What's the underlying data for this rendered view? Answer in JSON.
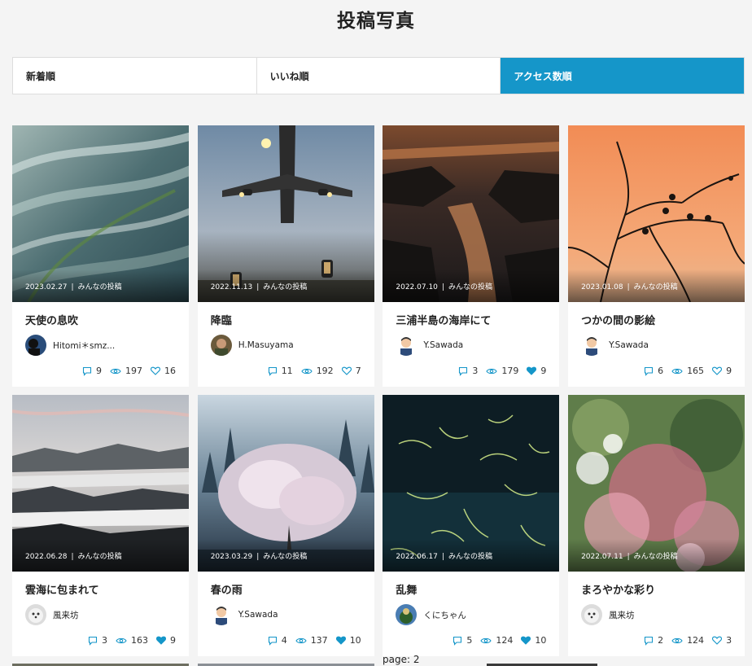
{
  "page": {
    "title": "投稿写真",
    "pager": "page: 2"
  },
  "sort_tabs": [
    {
      "label": "新着順",
      "active": false
    },
    {
      "label": "いいね順",
      "active": false
    },
    {
      "label": "アクセス数順",
      "active": true
    }
  ],
  "posts": [
    {
      "date": "2023.02.27",
      "category": "みんなの投稿",
      "title": "天使の息吹",
      "author": "Hitomi＊smz...",
      "comments": "9",
      "views": "197",
      "likes": "16",
      "liked": false,
      "avatar": "hitomi"
    },
    {
      "date": "2022.11.13",
      "category": "みんなの投稿",
      "title": "降臨",
      "author": "H.Masuyama",
      "comments": "11",
      "views": "192",
      "likes": "7",
      "liked": false,
      "avatar": "masuyama"
    },
    {
      "date": "2022.07.10",
      "category": "みんなの投稿",
      "title": "三浦半島の海岸にて",
      "author": "Y.Sawada",
      "comments": "3",
      "views": "179",
      "likes": "9",
      "liked": true,
      "avatar": "sawada"
    },
    {
      "date": "2023.01.08",
      "category": "みんなの投稿",
      "title": "つかの間の影絵",
      "author": "Y.Sawada",
      "comments": "6",
      "views": "165",
      "likes": "9",
      "liked": false,
      "avatar": "sawada"
    },
    {
      "date": "2022.06.28",
      "category": "みんなの投稿",
      "title": "雲海に包まれて",
      "author": "風来坊",
      "comments": "3",
      "views": "163",
      "likes": "9",
      "liked": true,
      "avatar": "furaibo"
    },
    {
      "date": "2023.03.29",
      "category": "みんなの投稿",
      "title": "春の雨",
      "author": "Y.Sawada",
      "comments": "4",
      "views": "137",
      "likes": "10",
      "liked": true,
      "avatar": "sawada"
    },
    {
      "date": "2022.06.17",
      "category": "みんなの投稿",
      "title": "乱舞",
      "author": "くにちゃん",
      "comments": "5",
      "views": "124",
      "likes": "10",
      "liked": true,
      "avatar": "kuni"
    },
    {
      "date": "2022.07.11",
      "category": "みんなの投稿",
      "title": "まろやかな彩り",
      "author": "風来坊",
      "comments": "2",
      "views": "124",
      "likes": "3",
      "liked": false,
      "avatar": "furaibo"
    }
  ],
  "colors": {
    "accent": "#1596c9",
    "background": "#f4f4f4"
  },
  "icons": {
    "comments": "comment-icon",
    "views": "eye-icon",
    "likes": "heart-icon"
  }
}
